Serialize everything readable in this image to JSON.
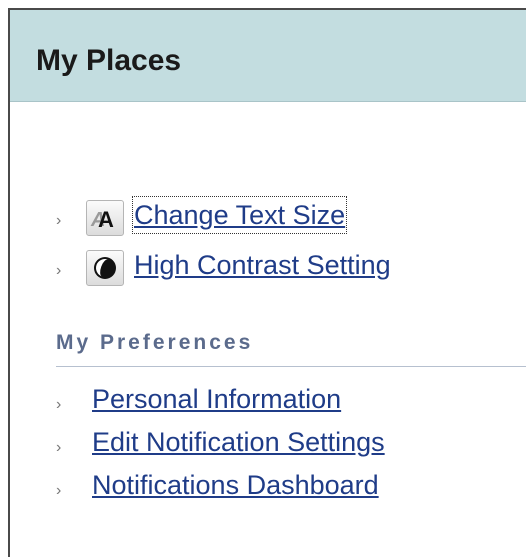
{
  "panel": {
    "title": "My Places"
  },
  "accessibility_tools": [
    {
      "label": "Change Text Size",
      "icon": "text-size-icon",
      "focused": true
    },
    {
      "label": "High Contrast Setting",
      "icon": "contrast-icon",
      "focused": false
    }
  ],
  "preferences": {
    "heading": "My Preferences",
    "items": [
      {
        "label": "Personal Information"
      },
      {
        "label": "Edit Notification Settings"
      },
      {
        "label": "Notifications Dashboard"
      }
    ]
  },
  "colors": {
    "header_bg": "#c3dde0",
    "link": "#1f3c88",
    "heading": "#5b6b8c"
  }
}
